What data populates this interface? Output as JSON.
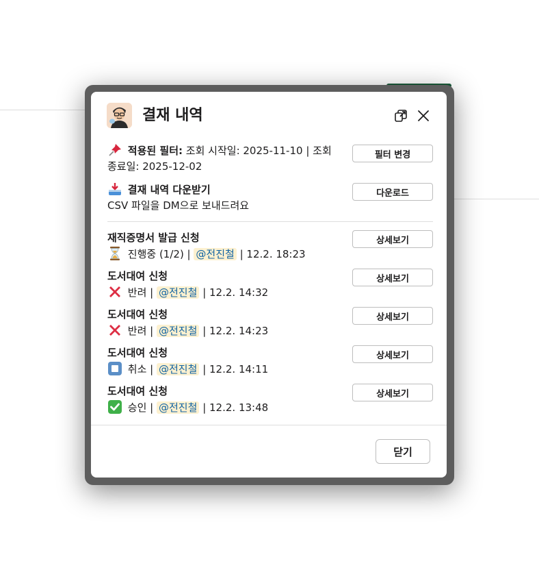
{
  "modal": {
    "title": "결재 내역",
    "filter": {
      "label": "적용된 필터:",
      "text": "조회 시작일: 2025-11-10 | 조회 종료일: 2025-12-02",
      "button": "필터 변경"
    },
    "download": {
      "label": "결재 내역 다운받기",
      "text": "CSV 파일을 DM으로 보내드려요",
      "button": "다운로드"
    },
    "items": [
      {
        "title": "재직증명서 발급 신청",
        "status_icon": "hourglass-icon",
        "status": "진행중 (1/2) |",
        "mention": "@전진철",
        "time": "| 12.2. 18:23",
        "button": "상세보기"
      },
      {
        "title": "도서대여 신청",
        "status_icon": "cross-mark-icon",
        "status": "반려 |",
        "mention": "@전진철",
        "time": "| 12.2. 14:32",
        "button": "상세보기"
      },
      {
        "title": "도서대여 신청",
        "status_icon": "cross-mark-icon",
        "status": "반려 |",
        "mention": "@전진철",
        "time": "| 12.2. 14:23",
        "button": "상세보기"
      },
      {
        "title": "도서대여 신청",
        "status_icon": "stop-button-icon",
        "status": "취소 |",
        "mention": "@전진철",
        "time": "| 12.2. 14:11",
        "button": "상세보기"
      },
      {
        "title": "도서대여 신청",
        "status_icon": "check-mark-icon",
        "status": "승인 |",
        "mention": "@전진철",
        "time": "| 12.2. 13:48",
        "button": "상세보기"
      }
    ],
    "close_button": "닫기"
  },
  "colors": {
    "mention_bg": "#fdf1d0",
    "mention_text": "#1264a3",
    "frame": "#5d5d5d"
  }
}
